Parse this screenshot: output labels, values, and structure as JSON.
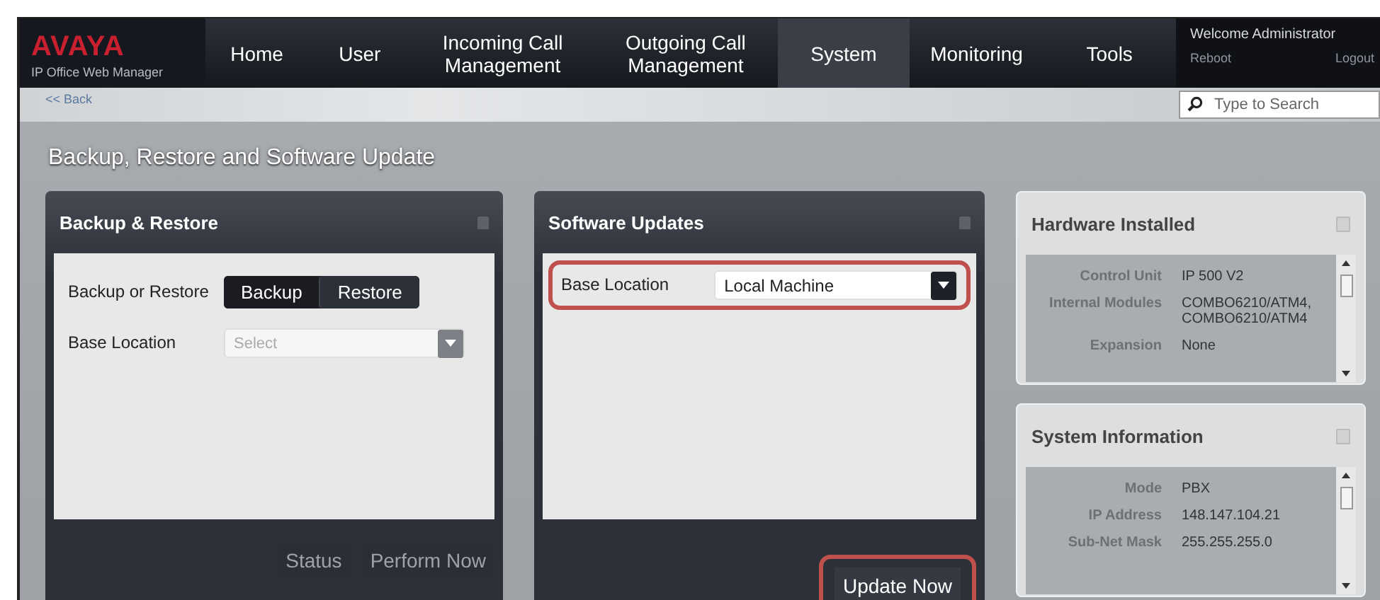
{
  "logo": {
    "brand": "AVAYA",
    "product": "IP Office Web Manager"
  },
  "nav": [
    {
      "label": "Home",
      "selected": false
    },
    {
      "label": "User",
      "selected": false
    },
    {
      "label": "Incoming Call Management",
      "selected": false
    },
    {
      "label": "Outgoing Call Management",
      "selected": false
    },
    {
      "label": "System",
      "selected": true
    },
    {
      "label": "Monitoring",
      "selected": false
    },
    {
      "label": "Tools",
      "selected": false
    }
  ],
  "user": {
    "welcome": "Welcome Administrator",
    "reboot": "Reboot",
    "logout": "Logout"
  },
  "back": "<< Back",
  "search": {
    "placeholder": "Type to Search"
  },
  "page_title": "Backup, Restore and Software Update",
  "backup_panel": {
    "title": "Backup & Restore",
    "mode_label": "Backup or Restore",
    "modes": [
      {
        "label": "Backup",
        "selected": true
      },
      {
        "label": "Restore",
        "selected": false
      }
    ],
    "location_label": "Base Location",
    "location_placeholder": "Select",
    "buttons": [
      "Status",
      "Perform Now"
    ]
  },
  "update_panel": {
    "title": "Software Updates",
    "location_label": "Base Location",
    "location_value": "Local Machine",
    "button": "Update Now"
  },
  "hardware": {
    "title": "Hardware Installed",
    "rows": [
      {
        "label": "Control Unit",
        "value": "IP 500 V2"
      },
      {
        "label": "Internal Modules",
        "value": "COMBO6210/ATM4, COMBO6210/ATM4"
      },
      {
        "label": "Expansion",
        "value": "None"
      }
    ]
  },
  "system_info": {
    "title": "System Information",
    "rows": [
      {
        "label": "Mode",
        "value": "PBX"
      },
      {
        "label": "IP Address",
        "value": "148.147.104.21"
      },
      {
        "label": "Sub-Net Mask",
        "value": "255.255.255.0"
      }
    ]
  }
}
